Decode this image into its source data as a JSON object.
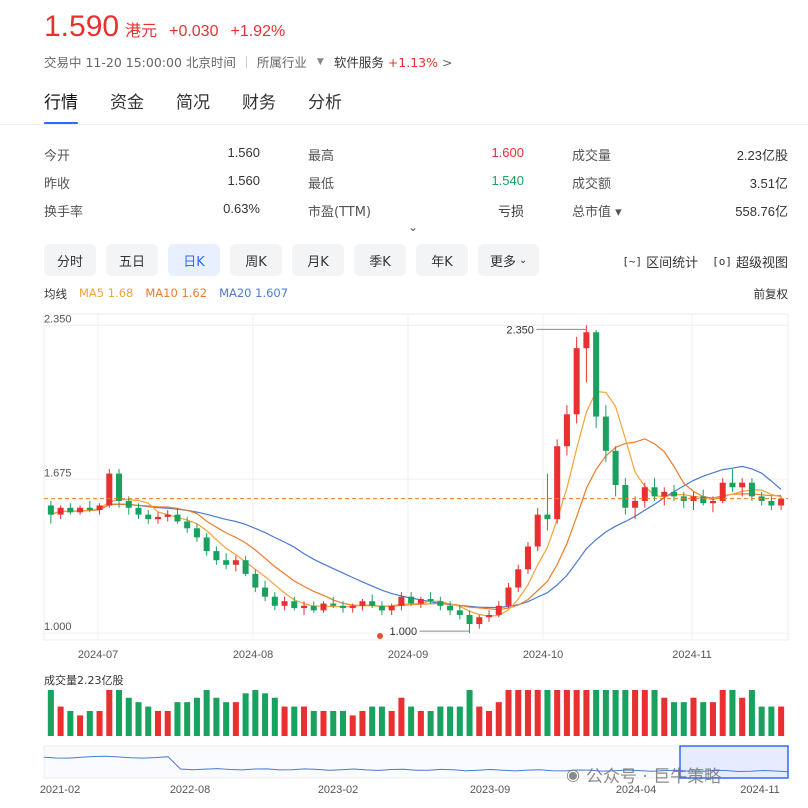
{
  "quote": {
    "price": "1.590",
    "unit": "港元",
    "change": "+0.030",
    "change_pct": "+1.92%"
  },
  "status": {
    "text": "交易中 11-20 15:00:00 北京时间",
    "industry_label": "所属行业",
    "industry_name": "软件服务",
    "industry_pct": "+1.13%"
  },
  "tabs": [
    "行情",
    "资金",
    "简况",
    "财务",
    "分析"
  ],
  "stats": [
    [
      {
        "label": "今开",
        "value": "1.560"
      },
      {
        "label": "最高",
        "value": "1.600",
        "tone": "red"
      },
      {
        "label": "成交量",
        "value": "2.23亿股"
      }
    ],
    [
      {
        "label": "昨收",
        "value": "1.560"
      },
      {
        "label": "最低",
        "value": "1.540",
        "tone": "green"
      },
      {
        "label": "成交额",
        "value": "3.51亿"
      }
    ],
    [
      {
        "label": "换手率",
        "value": "0.63%"
      },
      {
        "label": "市盈(TTM)",
        "value": "亏损"
      },
      {
        "label": "总市值 ▾",
        "value": "558.76亿"
      }
    ]
  ],
  "periods": [
    "分时",
    "五日",
    "日K",
    "周K",
    "月K",
    "季K",
    "年K",
    "更多"
  ],
  "tools": {
    "range_stats": "区间统计",
    "super_view": "超级视图"
  },
  "ma": {
    "label": "均线",
    "ma5": "MA5 1.68",
    "ma10": "MA10 1.62",
    "ma20": "MA20 1.607"
  },
  "adjust": "前复权",
  "colors": {
    "up": "#e93030",
    "down": "#19a15f",
    "ma5": "#f2a33a",
    "ma10": "#ee7b2c",
    "ma20": "#4a7bd0",
    "accent": "#2f6bff"
  },
  "watermark": "公众号 · 巨牛策略",
  "chart_data": {
    "type": "candlestick",
    "price_axis_ticks": [
      "2.350",
      "1.675",
      "1.000"
    ],
    "date_labels": [
      "2024-07",
      "2024-08",
      "2024-09",
      "2024-10",
      "2024-11"
    ],
    "annotations": {
      "high": "2.350",
      "low": "1.000"
    },
    "current_price": 1.59,
    "ohlc_sample": [
      [
        1.56,
        1.58,
        1.48,
        1.52
      ],
      [
        1.52,
        1.56,
        1.5,
        1.55
      ],
      [
        1.55,
        1.57,
        1.52,
        1.53
      ],
      [
        1.53,
        1.56,
        1.52,
        1.55
      ],
      [
        1.55,
        1.58,
        1.53,
        1.54
      ],
      [
        1.54,
        1.57,
        1.52,
        1.56
      ],
      [
        1.56,
        1.72,
        1.55,
        1.7
      ],
      [
        1.7,
        1.72,
        1.55,
        1.58
      ],
      [
        1.58,
        1.6,
        1.52,
        1.55
      ],
      [
        1.55,
        1.57,
        1.5,
        1.52
      ],
      [
        1.52,
        1.54,
        1.48,
        1.5
      ],
      [
        1.5,
        1.53,
        1.48,
        1.51
      ],
      [
        1.51,
        1.54,
        1.49,
        1.52
      ],
      [
        1.52,
        1.55,
        1.48,
        1.49
      ],
      [
        1.49,
        1.51,
        1.44,
        1.46
      ],
      [
        1.46,
        1.48,
        1.4,
        1.42
      ],
      [
        1.42,
        1.44,
        1.34,
        1.36
      ],
      [
        1.36,
        1.38,
        1.3,
        1.32
      ],
      [
        1.32,
        1.35,
        1.28,
        1.3
      ],
      [
        1.3,
        1.34,
        1.27,
        1.32
      ],
      [
        1.32,
        1.34,
        1.25,
        1.26
      ],
      [
        1.26,
        1.28,
        1.18,
        1.2
      ],
      [
        1.2,
        1.23,
        1.14,
        1.16
      ],
      [
        1.16,
        1.18,
        1.1,
        1.12
      ],
      [
        1.12,
        1.16,
        1.1,
        1.14
      ],
      [
        1.14,
        1.16,
        1.1,
        1.11
      ],
      [
        1.11,
        1.14,
        1.08,
        1.12
      ],
      [
        1.12,
        1.14,
        1.09,
        1.1
      ],
      [
        1.1,
        1.14,
        1.09,
        1.13
      ],
      [
        1.13,
        1.16,
        1.11,
        1.12
      ],
      [
        1.12,
        1.14,
        1.09,
        1.11
      ],
      [
        1.11,
        1.13,
        1.09,
        1.12
      ],
      [
        1.12,
        1.15,
        1.1,
        1.14
      ],
      [
        1.14,
        1.17,
        1.11,
        1.12
      ],
      [
        1.12,
        1.14,
        1.08,
        1.1
      ],
      [
        1.1,
        1.13,
        1.08,
        1.12
      ],
      [
        1.12,
        1.18,
        1.1,
        1.16
      ],
      [
        1.16,
        1.18,
        1.12,
        1.13
      ],
      [
        1.13,
        1.16,
        1.11,
        1.15
      ],
      [
        1.15,
        1.18,
        1.13,
        1.14
      ],
      [
        1.14,
        1.16,
        1.1,
        1.12
      ],
      [
        1.12,
        1.14,
        1.08,
        1.1
      ],
      [
        1.1,
        1.12,
        1.06,
        1.08
      ],
      [
        1.08,
        1.1,
        1.0,
        1.04
      ],
      [
        1.04,
        1.08,
        1.02,
        1.07
      ],
      [
        1.07,
        1.1,
        1.05,
        1.08
      ],
      [
        1.08,
        1.14,
        1.07,
        1.12
      ],
      [
        1.12,
        1.22,
        1.11,
        1.2
      ],
      [
        1.2,
        1.3,
        1.18,
        1.28
      ],
      [
        1.28,
        1.4,
        1.26,
        1.38
      ],
      [
        1.38,
        1.55,
        1.36,
        1.52
      ],
      [
        1.52,
        1.7,
        1.45,
        1.5
      ],
      [
        1.5,
        1.85,
        1.48,
        1.82
      ],
      [
        1.82,
        2.0,
        1.78,
        1.96
      ],
      [
        1.96,
        2.3,
        1.92,
        2.25
      ],
      [
        2.25,
        2.35,
        2.1,
        2.32
      ],
      [
        2.32,
        2.33,
        1.9,
        1.95
      ],
      [
        1.95,
        2.0,
        1.75,
        1.8
      ],
      [
        1.8,
        1.82,
        1.6,
        1.65
      ],
      [
        1.65,
        1.68,
        1.52,
        1.55
      ],
      [
        1.55,
        1.6,
        1.5,
        1.58
      ],
      [
        1.58,
        1.66,
        1.55,
        1.64
      ],
      [
        1.64,
        1.68,
        1.58,
        1.6
      ],
      [
        1.6,
        1.64,
        1.56,
        1.62
      ],
      [
        1.62,
        1.65,
        1.58,
        1.6
      ],
      [
        1.6,
        1.62,
        1.55,
        1.58
      ],
      [
        1.58,
        1.62,
        1.54,
        1.6
      ],
      [
        1.6,
        1.63,
        1.56,
        1.57
      ],
      [
        1.57,
        1.6,
        1.53,
        1.58
      ],
      [
        1.58,
        1.68,
        1.57,
        1.66
      ],
      [
        1.66,
        1.72,
        1.62,
        1.64
      ],
      [
        1.64,
        1.68,
        1.6,
        1.66
      ],
      [
        1.66,
        1.68,
        1.58,
        1.6
      ],
      [
        1.6,
        1.62,
        1.56,
        1.58
      ],
      [
        1.58,
        1.6,
        1.54,
        1.56
      ],
      [
        1.56,
        1.6,
        1.54,
        1.59
      ]
    ],
    "volume_label": "成交量2.23亿股",
    "overview_dates": [
      "2021-02",
      "2022-08",
      "2023-02",
      "2023-09",
      "2024-04",
      "2024-11"
    ]
  }
}
